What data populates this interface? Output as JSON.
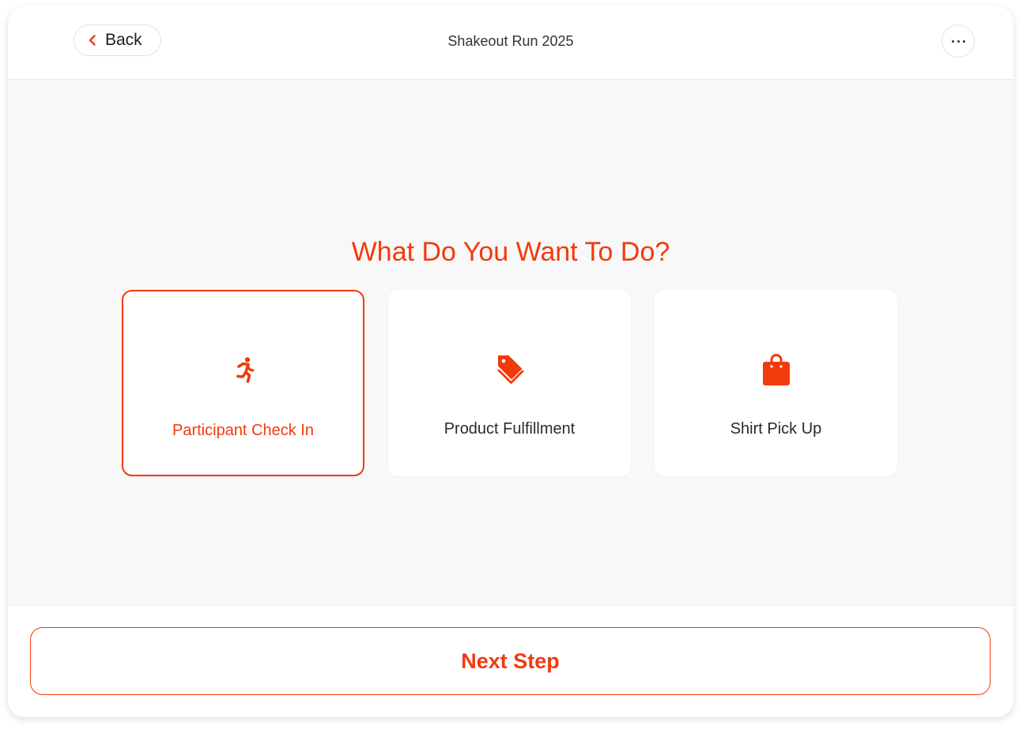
{
  "header": {
    "back_label": "Back",
    "title": "Shakeout Run 2025",
    "more_icon": "ellipsis-icon"
  },
  "main": {
    "heading": "What Do You Want To Do?",
    "options": [
      {
        "label": "Participant Check In",
        "icon": "running-person-icon",
        "selected": true
      },
      {
        "label": "Product Fulfillment",
        "icon": "tags-icon",
        "selected": false
      },
      {
        "label": "Shirt Pick Up",
        "icon": "shopping-bag-icon",
        "selected": false
      }
    ]
  },
  "footer": {
    "next_label": "Next Step"
  },
  "colors": {
    "accent": "#f23a0c",
    "background": "#f8f8f8",
    "card": "#ffffff",
    "text": "#2a2a2a"
  }
}
